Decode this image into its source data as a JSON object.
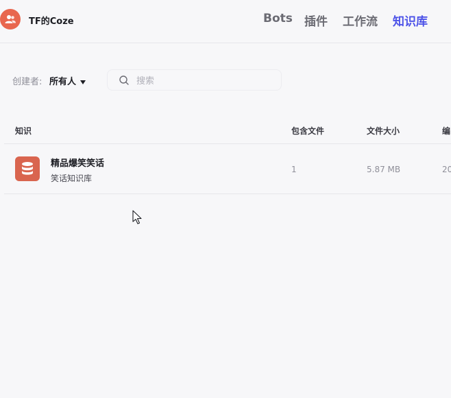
{
  "header": {
    "team_name": "TF的Coze",
    "avatar_icon": "users-icon",
    "nav": [
      {
        "label": "Bots",
        "active": false
      },
      {
        "label": "插件",
        "active": false
      },
      {
        "label": "工作流",
        "active": false
      },
      {
        "label": "知识库",
        "active": true
      }
    ]
  },
  "filters": {
    "creator_label": "创建者:",
    "creator_value": "所有人",
    "search_placeholder": "搜索"
  },
  "table": {
    "columns": [
      "知识",
      "包含文件",
      "文件大小",
      "编"
    ],
    "rows": [
      {
        "icon": "database-icon",
        "name": "精品爆笑笑话",
        "description": "笑话知识库",
        "files": "1",
        "size": "5.87 MB",
        "edited": "20"
      }
    ]
  },
  "colors": {
    "accent": "#4d53e8",
    "avatar": "#e8674f",
    "kb_icon": "#d9654f"
  }
}
